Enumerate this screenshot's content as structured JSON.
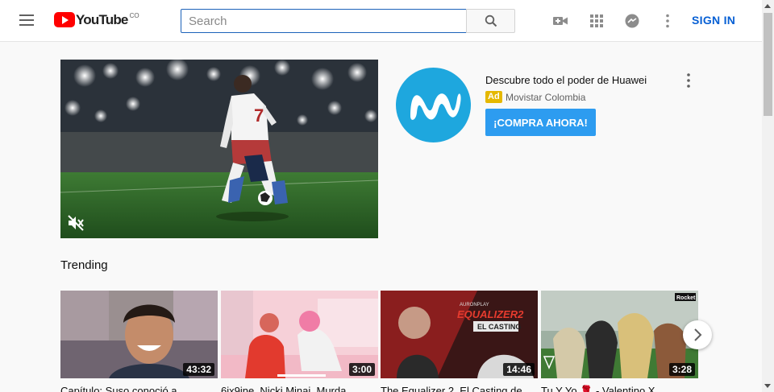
{
  "header": {
    "logo_text": "YouTube",
    "country_code": "CO",
    "search_placeholder": "Search",
    "signin_label": "SIGN IN",
    "icons": [
      "menu-icon",
      "search-icon",
      "create-video-icon",
      "apps-grid-icon",
      "messages-icon",
      "more-vert-icon"
    ]
  },
  "ad": {
    "title": "Descubre todo el poder de Huawei",
    "badge": "Ad",
    "advertiser": "Movistar Colombia",
    "cta_label": "¡COMPRA AHORA!",
    "video_player_number": "7",
    "logo_color": "#1ea7de",
    "cta_color": "#2d9cf0"
  },
  "trending": {
    "title": "Trending",
    "videos": [
      {
        "title": "Capítulo: Suso conoció a",
        "duration": "43:32"
      },
      {
        "title": "6ix9ine, Nicki Minaj, Murda",
        "duration": "3:00"
      },
      {
        "title": "The Equalizer 2. El Casting de",
        "duration": "14:46"
      },
      {
        "title": "Tu Y Yo 🌹 - Valentino X",
        "duration": "3:28"
      }
    ],
    "thumbnail_text": {
      "equalizer_brand": "AURONPLAY",
      "equalizer_title": "EQUALIZER2",
      "equalizer_subtitle": "EL CASTING",
      "rocket_tag": "Rocket"
    }
  }
}
